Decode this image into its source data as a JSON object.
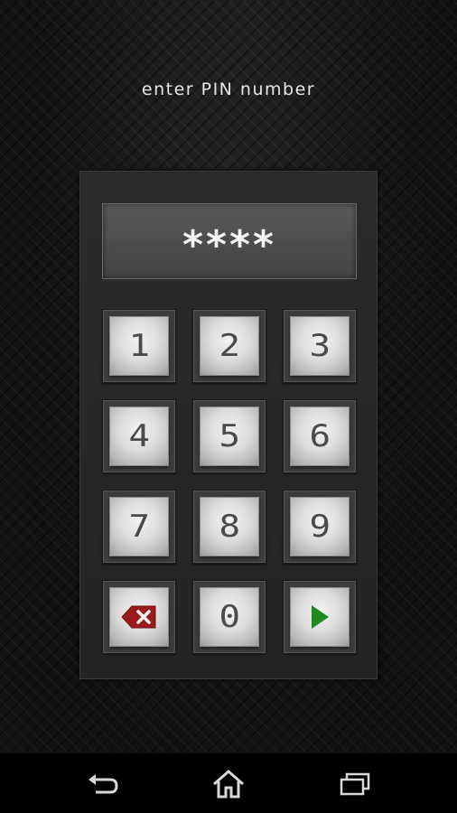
{
  "header": {
    "title": "enter PIN number"
  },
  "display": {
    "value": "****"
  },
  "keypad": {
    "keys": [
      {
        "label": "1"
      },
      {
        "label": "2"
      },
      {
        "label": "3"
      },
      {
        "label": "4"
      },
      {
        "label": "5"
      },
      {
        "label": "6"
      },
      {
        "label": "7"
      },
      {
        "label": "8"
      },
      {
        "label": "9"
      },
      {
        "label": "",
        "icon": "backspace-icon"
      },
      {
        "label": "0"
      },
      {
        "label": "",
        "icon": "enter-arrow-icon"
      }
    ]
  },
  "colors": {
    "delete": "#9c1c1c",
    "enter": "#1e8a1e",
    "key_text": "#4a4a4a"
  },
  "navbar": {
    "buttons": [
      {
        "icon": "back-icon"
      },
      {
        "icon": "home-icon"
      },
      {
        "icon": "recent-apps-icon"
      }
    ]
  }
}
